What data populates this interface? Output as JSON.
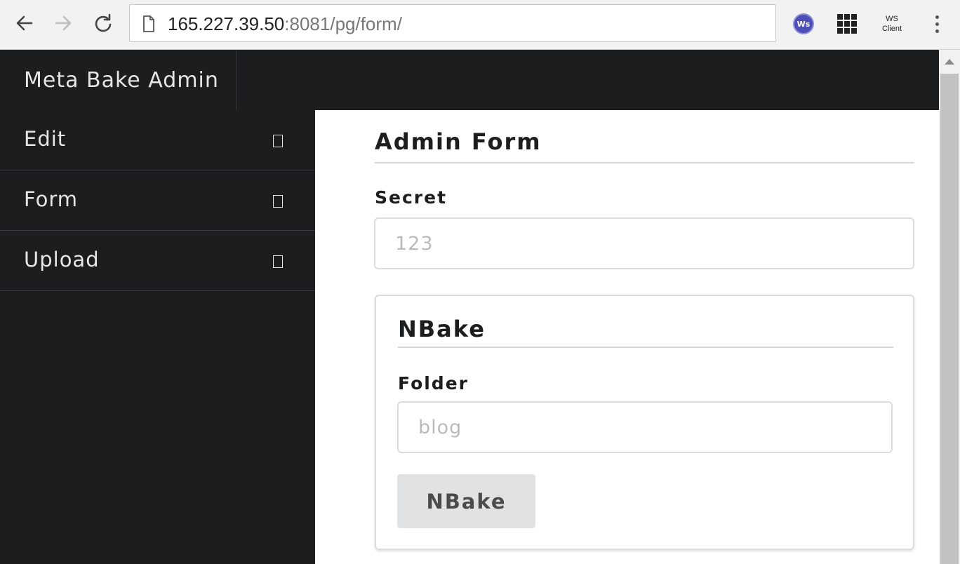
{
  "browser": {
    "url_host": "165.227.39.50",
    "url_rest": ":8081/pg/form/",
    "extensions": {
      "ws_badge": "Ws",
      "ws_client_line1": "WS",
      "ws_client_line2": "Client"
    },
    "icons": [
      "back-icon",
      "forward-icon",
      "reload-icon",
      "page-icon",
      "apps-icon",
      "menu-icon"
    ]
  },
  "app": {
    "brand": "Meta Bake Admin"
  },
  "sidebar": {
    "items": [
      {
        "label": "Edit"
      },
      {
        "label": "Form"
      },
      {
        "label": "Upload"
      }
    ]
  },
  "form": {
    "title": "Admin Form",
    "secret_label": "Secret",
    "secret_placeholder": "123",
    "nbake": {
      "title": "NBake",
      "folder_label": "Folder",
      "folder_placeholder": "blog",
      "button_label": "NBake"
    }
  },
  "colors": {
    "page_dark": "#1c1d1f",
    "content_bg": "#ffffff",
    "button_bg": "#e1e2e4"
  }
}
